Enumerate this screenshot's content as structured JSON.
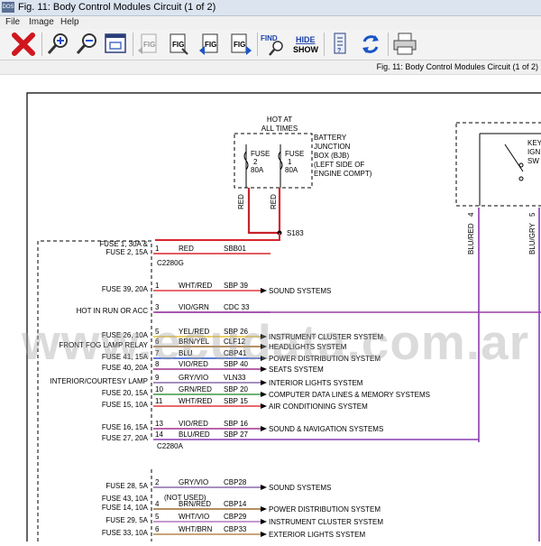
{
  "window": {
    "title": "Fig. 11: Body Control Modules Circuit (1 of 2)",
    "app_icon": "DOS"
  },
  "menu": [
    {
      "label": "File"
    },
    {
      "label": "Image"
    },
    {
      "label": "Help"
    }
  ],
  "toolbar": {
    "find_label": "FIND",
    "hide_label": "HIDE",
    "show_label": "SHOW",
    "fig_label": "FIG"
  },
  "header": {
    "figure_title": "Fig. 11: Body Control Modules Circuit (1 of 2)"
  },
  "diagram": {
    "hot_label": [
      "HOT AT",
      "ALL TIMES"
    ],
    "bjb_label": [
      "BATTERY",
      "JUNCTION",
      "BOX (BJB)",
      "(LEFT SIDE OF",
      "ENGINE COMPT)"
    ],
    "fuse_a": [
      "FUSE",
      "2",
      "80A"
    ],
    "fuse_b": [
      "FUSE",
      "1",
      "80A"
    ],
    "bjb_wire_color": "RED",
    "splice": "S183",
    "right_wires": [
      "BLU/RED",
      "BLU/GRY"
    ],
    "right_pins": [
      "4",
      "5"
    ],
    "right_box_label": [
      "KEY",
      "IGN",
      "SW"
    ],
    "connector_a": "C2280G",
    "connector_b": "C2280A",
    "watermark": "www.ecudata.com.ar",
    "not_used": "(NOT USED)",
    "block_a": [
      {
        "left": [
          "FUSE 1, 30A &",
          "FUSE 2, 15A"
        ],
        "pin": "1",
        "color": "RED",
        "circuit": "SBB01",
        "dest": "",
        "stroke": "#d8262e"
      },
      {
        "left": [
          "FUSE 39, 20A"
        ],
        "pin": "1",
        "color": "WHT/RED",
        "circuit": "SBP 39",
        "dest": "SOUND SYSTEMS",
        "stroke": "#e0383f"
      },
      {
        "left": [
          "HOT IN RUN OR ACC"
        ],
        "pin": "3",
        "color": "VIO/GRN",
        "circuit": "CDC 33",
        "dest": "",
        "stroke": "#9c3fa5"
      },
      {
        "left": [
          "FUSE 26, 10A"
        ],
        "pin": "5",
        "color": "YEL/RED",
        "circuit": "SBP 26",
        "dest": "INSTRUMENT CLUSTER SYSTEM",
        "stroke": "#e8c23a"
      },
      {
        "left": [
          "FRONT FOG LAMP RELAY"
        ],
        "pin": "6",
        "color": "BRN/YEL",
        "circuit": "CLF12",
        "dest": "HEADLIGHTS SYSTEM",
        "stroke": "#9b6a2f"
      },
      {
        "left": [
          "FUSE 41, 15A"
        ],
        "pin": "7",
        "color": "BLU",
        "circuit": "CBP41",
        "dest": "POWER DISTRIBUTION SYSTEM",
        "stroke": "#2f55c8"
      },
      {
        "left": [
          "FUSE 40, 20A"
        ],
        "pin": "8",
        "color": "VIO/RED",
        "circuit": "SBP 40",
        "dest": "SEATS SYSTEM",
        "stroke": "#a2308e"
      },
      {
        "left": [
          "INTERIOR/COURTESY LAMP"
        ],
        "pin": "9",
        "color": "GRY/VIO",
        "circuit": "VLN33",
        "dest": "INTERIOR LIGHTS SYSTEM",
        "stroke": "#8a6aa8"
      },
      {
        "left": [
          "FUSE 20, 15A"
        ],
        "pin": "10",
        "color": "GRN/RED",
        "circuit": "SBP 20",
        "dest": "COMPUTER DATA LINES & MEMORY SYSTEMS",
        "stroke": "#3c9a48"
      },
      {
        "left": [
          "FUSE 15, 10A"
        ],
        "pin": "11",
        "color": "WHT/RED",
        "circuit": "SBP 15",
        "dest": "AIR CONDITIONING SYSTEM",
        "stroke": "#e0383f"
      },
      {
        "left": [
          "FUSE 16, 15A"
        ],
        "pin": "13",
        "color": "VIO/RED",
        "circuit": "SBP 16",
        "dest": "SOUND & NAVIGATION SYSTEMS",
        "stroke": "#a2308e"
      },
      {
        "left": [
          "FUSE 27, 20A"
        ],
        "pin": "14",
        "color": "BLU/RED",
        "circuit": "SBP 27",
        "dest": "",
        "stroke": "#8a3bb0"
      }
    ],
    "block_b": [
      {
        "left": [
          "FUSE 28, 5A"
        ],
        "pin": "2",
        "color": "GRY/VIO",
        "circuit": "CBP28",
        "dest": "SOUND SYSTEMS",
        "stroke": "#8a6aa8"
      },
      {
        "left": [
          "FUSE 43, 10A"
        ],
        "pin": "",
        "color": "",
        "circuit": "",
        "dest": "",
        "stroke": ""
      },
      {
        "left": [
          "FUSE 14, 10A"
        ],
        "pin": "4",
        "color": "BRN/RED",
        "circuit": "CBP14",
        "dest": "POWER DISTRIBUTION SYSTEM",
        "stroke": "#9b6a2f"
      },
      {
        "left": [
          "FUSE 29, 5A"
        ],
        "pin": "5",
        "color": "WHT/VIO",
        "circuit": "CBP29",
        "dest": "INSTRUMENT CLUSTER SYSTEM",
        "stroke": "#b07ac0"
      },
      {
        "left": [
          "FUSE 33, 10A"
        ],
        "pin": "6",
        "color": "WHT/BRN",
        "circuit": "CBP33",
        "dest": "EXTERIOR LIGHTS SYSTEM",
        "stroke": "#b8874a"
      }
    ]
  }
}
